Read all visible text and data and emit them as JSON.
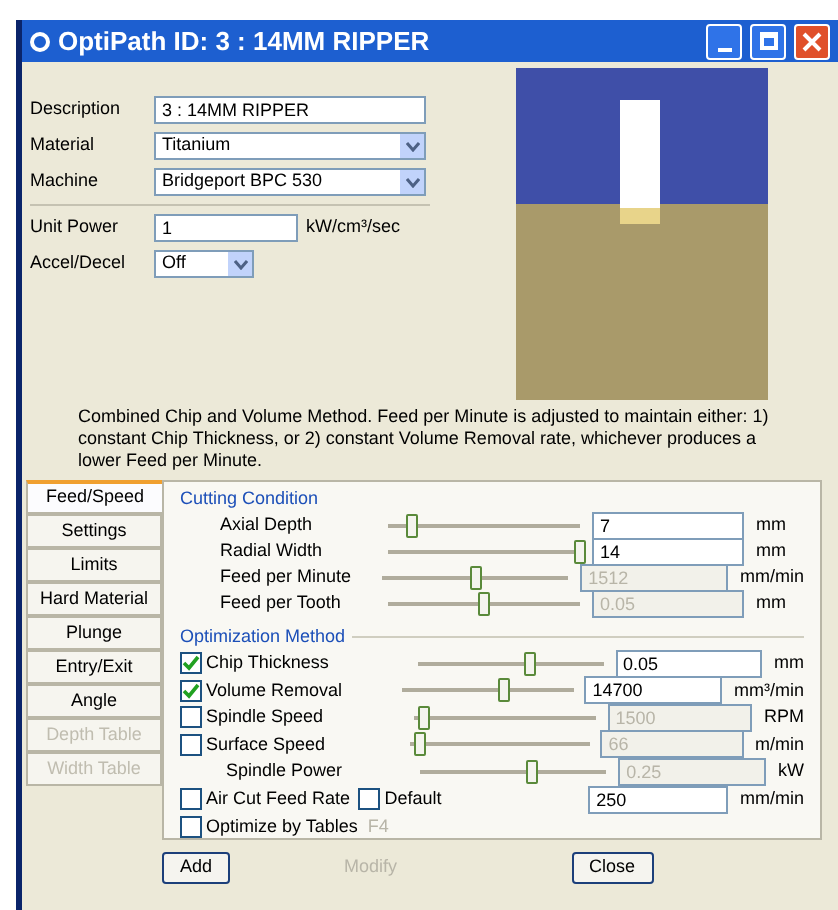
{
  "window": {
    "title": "OptiPath ID: 3 : 14MM RIPPER"
  },
  "form": {
    "description": {
      "label": "Description",
      "value": "3 : 14MM RIPPER"
    },
    "material": {
      "label": "Material",
      "value": "Titanium"
    },
    "machine": {
      "label": "Machine",
      "value": "Bridgeport BPC 530"
    },
    "unit_power": {
      "label": "Unit Power",
      "value": "1",
      "unit": "kW/cm³/sec"
    },
    "accel_decel": {
      "label": "Accel/Decel",
      "value": "Off"
    }
  },
  "info_text": "Combined Chip and Volume Method. Feed per Minute is adjusted to maintain either: 1) constant Chip Thickness, or 2) constant Volume Removal rate, whichever produces a lower Feed per Minute.",
  "tabs": [
    {
      "label": "Feed/Speed",
      "selected": true,
      "disabled": false
    },
    {
      "label": "Settings",
      "selected": false,
      "disabled": false
    },
    {
      "label": "Limits",
      "selected": false,
      "disabled": false
    },
    {
      "label": "Hard Material",
      "selected": false,
      "disabled": false
    },
    {
      "label": "Plunge",
      "selected": false,
      "disabled": false
    },
    {
      "label": "Entry/Exit",
      "selected": false,
      "disabled": false
    },
    {
      "label": "Angle",
      "selected": false,
      "disabled": false
    },
    {
      "label": "Depth Table",
      "selected": false,
      "disabled": true
    },
    {
      "label": "Width Table",
      "selected": false,
      "disabled": true
    }
  ],
  "cutting_condition": {
    "title": "Cutting Condition",
    "rows": [
      {
        "label": "Axial Depth",
        "level": 0.12,
        "value": "7",
        "unit": "mm",
        "disabled": false
      },
      {
        "label": "Radial Width",
        "level": 1,
        "value": "14",
        "unit": "mm",
        "disabled": false
      },
      {
        "label": "Feed per Minute",
        "level": 0.5,
        "value": "1512",
        "unit": "mm/min",
        "disabled": true
      },
      {
        "label": "Feed per Tooth",
        "level": 0.5,
        "value": "0.05",
        "unit": "mm",
        "disabled": true
      }
    ]
  },
  "optimization": {
    "title": "Optimization Method",
    "rows": [
      {
        "kind": "check",
        "label": "Chip Thickness",
        "checked": true,
        "level": 0.6,
        "value": "0.05",
        "unit": "mm",
        "disabled": false
      },
      {
        "kind": "check",
        "label": "Volume Removal",
        "checked": true,
        "level": 0.6,
        "value": "14700",
        "unit": "mm³/min",
        "disabled": false
      },
      {
        "kind": "check",
        "label": "Spindle Speed",
        "checked": false,
        "level": 0.05,
        "value": "1500",
        "unit": "RPM",
        "disabled": true
      },
      {
        "kind": "check",
        "label": "Surface Speed",
        "checked": false,
        "level": 0.05,
        "value": "66",
        "unit": "m/min",
        "disabled": true
      },
      {
        "kind": "plain",
        "label": "Spindle Power",
        "level": 0.6,
        "value": "0.25",
        "unit": "kW",
        "disabled": true
      }
    ],
    "air_cut": {
      "label": "Air Cut Feed Rate",
      "checked": false,
      "default_label": "Default",
      "default_checked": false,
      "value": "250",
      "unit": "mm/min"
    },
    "optimize_tables": {
      "label": "Optimize by Tables",
      "checked": false,
      "hint": "F4"
    }
  },
  "buttons": [
    {
      "label": "Add",
      "disabled": false
    },
    {
      "label": "Modify",
      "disabled": true
    },
    {
      "label": "Close",
      "disabled": false
    }
  ]
}
